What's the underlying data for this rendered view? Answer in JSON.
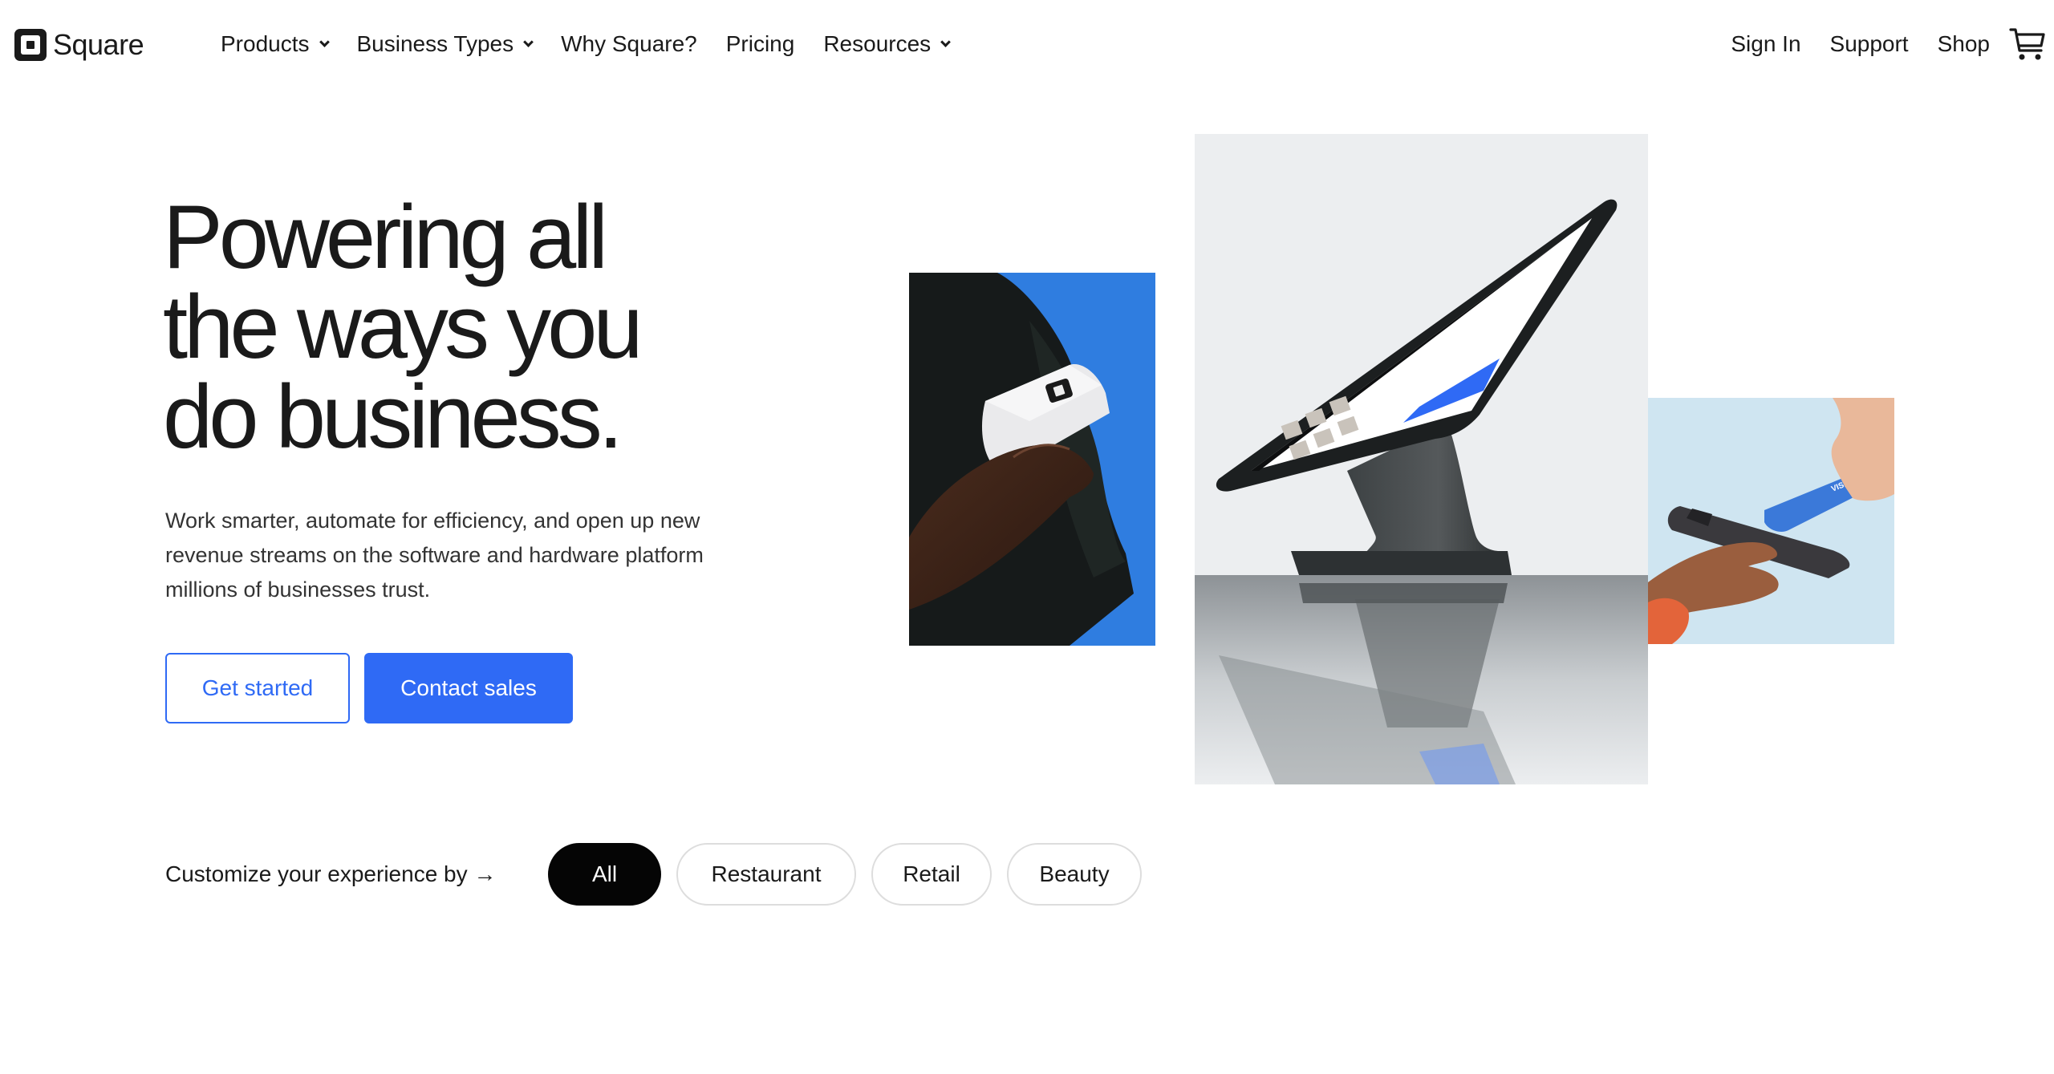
{
  "header": {
    "logo_text": "Square",
    "nav": [
      {
        "label": "Products",
        "has_dropdown": true
      },
      {
        "label": "Business Types",
        "has_dropdown": true
      },
      {
        "label": "Why Square?",
        "has_dropdown": false
      },
      {
        "label": "Pricing",
        "has_dropdown": false
      },
      {
        "label": "Resources",
        "has_dropdown": true
      }
    ],
    "right_links": [
      "Sign In",
      "Support",
      "Shop"
    ],
    "cart_icon": "shopping-cart-icon"
  },
  "hero": {
    "title_lines": [
      "Powering all",
      "the ways you",
      "do business."
    ],
    "subtitle": "Work smarter, automate for efficiency, and open up new revenue streams on the software and hardware platform millions of businesses trust.",
    "primary_cta": "Get started",
    "secondary_cta": "Contact sales"
  },
  "customize": {
    "label": "Customize your experience by →",
    "options": [
      {
        "label": "All",
        "selected": true
      },
      {
        "label": "Restaurant",
        "selected": false
      },
      {
        "label": "Retail",
        "selected": false
      },
      {
        "label": "Beauty",
        "selected": false
      }
    ]
  },
  "images": {
    "reader": "Hand holding Square card reader on blue background",
    "register": "Square Register POS terminal on reflective surface",
    "tap": "Hand tapping Visa card on smartphone on light blue background"
  },
  "colors": {
    "brand_blue": "#2f6af5",
    "text": "#1a1a1a",
    "chip_active": "#050505"
  }
}
